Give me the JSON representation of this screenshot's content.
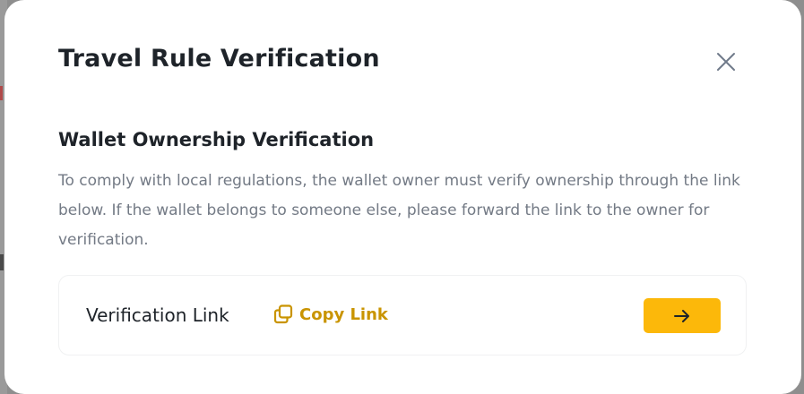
{
  "modal": {
    "title": "Travel Rule Verification",
    "close_icon": "close-icon"
  },
  "section": {
    "heading": "Wallet Ownership Verification",
    "description": "To comply with local regulations, the wallet owner must verify ownership through the link below. If the wallet belongs to someone else, please forward the link to the owner for verification."
  },
  "link_card": {
    "label": "Verification Link",
    "copy_label": "Copy Link",
    "copy_icon": "copy-icon",
    "arrow_icon": "arrow-right-icon"
  },
  "colors": {
    "accent": "#fcb80a",
    "accent_text": "#c99400",
    "primary_text": "#1e2329",
    "secondary_text": "#737a85"
  }
}
